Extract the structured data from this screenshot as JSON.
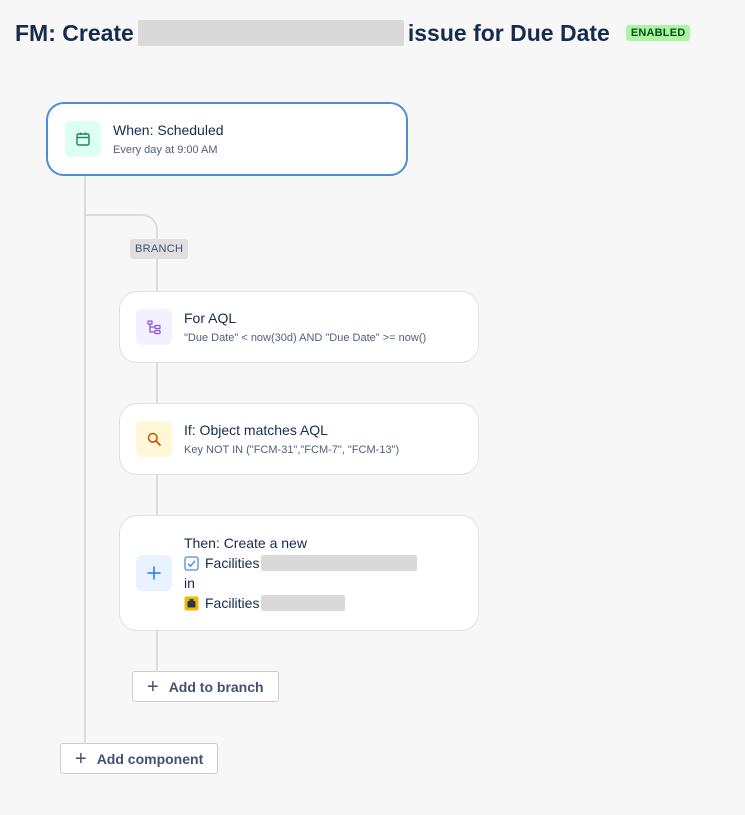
{
  "header": {
    "title_prefix": "FM: Create",
    "title_suffix": "issue for Due Date",
    "status_badge": "ENABLED"
  },
  "trigger": {
    "title": "When: Scheduled",
    "subtitle": "Every day at 9:00 AM",
    "icon": "calendar-icon"
  },
  "branch": {
    "label": "BRANCH",
    "components": [
      {
        "title": "For AQL",
        "subtitle": "\"Due Date\" < now(30d) AND \"Due Date\" >= now()",
        "icon": "hierarchy-icon"
      },
      {
        "title": "If: Object matches AQL",
        "subtitle": "Key NOT IN (\"FCM-31\",\"FCM-7\", \"FCM-13\")",
        "icon": "search-icon"
      },
      {
        "title": "Then: Create a new",
        "issue_type": "Facilities",
        "in_label": "in",
        "project": "Facilities",
        "icon": "plus-icon"
      }
    ],
    "add_to_branch_label": "Add to branch"
  },
  "add_component_label": "Add component",
  "colors": {
    "accent_blue": "#4c8ed9",
    "enabled_green": "#abf5a1",
    "trigger_icon_bg": "#dcfff1",
    "branch_icon_bg": "#f3f0ff",
    "condition_icon_bg": "#fff7d6",
    "action_icon_bg": "#e9f2ff"
  }
}
